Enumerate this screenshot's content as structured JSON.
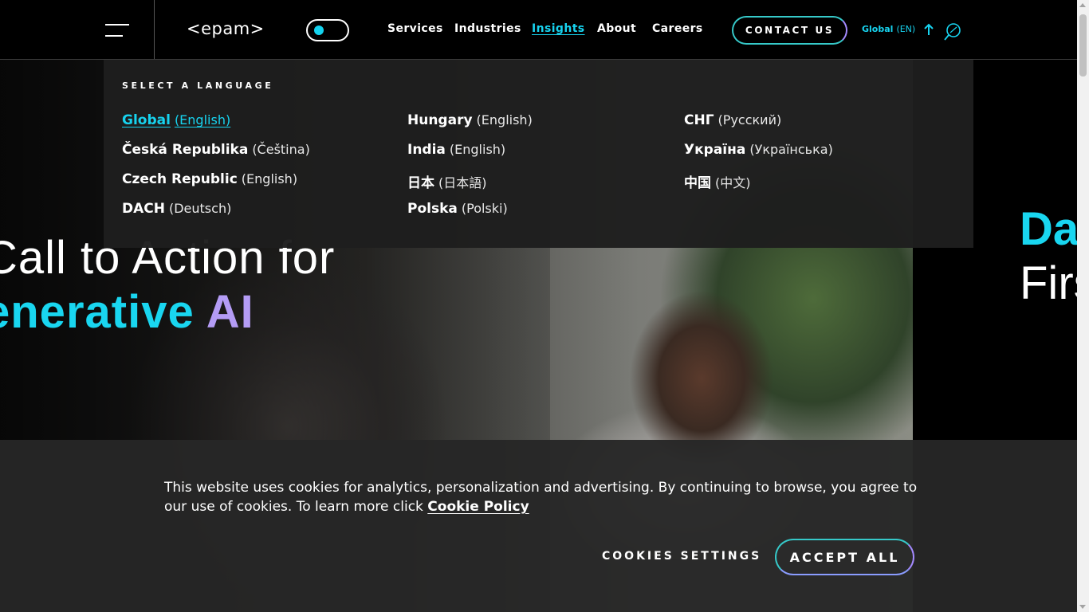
{
  "header": {
    "menu_icon": "hamburger-menu-icon",
    "logo": "<epam>",
    "theme_toggle_icon": "theme-toggle-icon",
    "nav": [
      {
        "label": "Services",
        "active": false
      },
      {
        "label": "Industries",
        "active": false
      },
      {
        "label": "Insights",
        "active": true
      },
      {
        "label": "About",
        "active": false
      },
      {
        "label": "Careers",
        "active": false
      }
    ],
    "contact_label": "CONTACT US",
    "language_selector": {
      "region": "Global",
      "code": "(EN)",
      "icon": "arrow-up-icon"
    },
    "search_icon": "search-icon"
  },
  "language_panel": {
    "heading": "SELECT A LANGUAGE",
    "columns": [
      [
        {
          "country": "Global",
          "language": "(English)",
          "active": true
        },
        {
          "country": "Česká Republika",
          "language": "(Čeština)",
          "active": false
        },
        {
          "country": "Czech Republic",
          "language": "(English)",
          "active": false
        },
        {
          "country": "DACH",
          "language": "(Deutsch)",
          "active": false
        }
      ],
      [
        {
          "country": "Hungary",
          "language": "(English)",
          "active": false
        },
        {
          "country": "India",
          "language": "(English)",
          "active": false
        },
        {
          "country": "日本",
          "language": "(日本語)",
          "active": false
        },
        {
          "country": "Polska",
          "language": "(Polski)",
          "active": false
        }
      ],
      [
        {
          "country": "СНГ",
          "language": "(Русский)",
          "active": false
        },
        {
          "country": "Україна",
          "language": "(Українська)",
          "active": false
        },
        {
          "country": "中国",
          "language": "(中文)",
          "active": false
        }
      ]
    ]
  },
  "hero": {
    "line1": "Call to Action for",
    "line2_word": "enerative",
    "line2_ai": "AI",
    "side_line1": "Da",
    "side_line2": "Firs"
  },
  "cookie_banner": {
    "text": "This website uses cookies for analytics, personalization and advertising. By continuing to browse, you agree to our use of cookies. To learn more click",
    "link": "Cookie Policy",
    "settings_label": "COOKIES SETTINGS",
    "accept_label": "ACCEPT ALL"
  },
  "colors": {
    "accent_cyan": "#17d3ef",
    "accent_purple": "#b49cf5",
    "background": "#000000",
    "panel": "#1e1e1e"
  }
}
